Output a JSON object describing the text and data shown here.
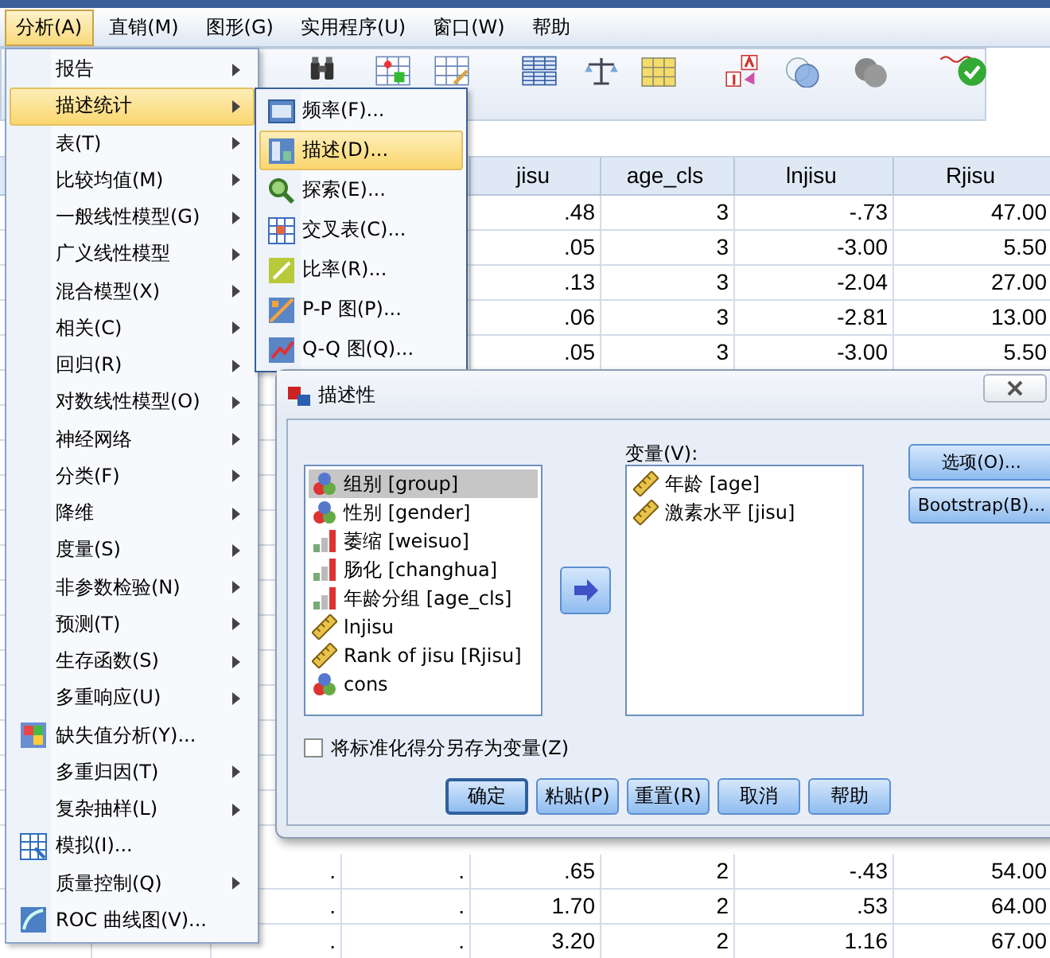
{
  "menubar": [
    {
      "label": "分析(A)",
      "selected": true
    },
    {
      "label": "直销(M)",
      "selected": false
    },
    {
      "label": "图形(G)",
      "selected": false
    },
    {
      "label": "实用程序(U)",
      "selected": false
    },
    {
      "label": "窗口(W)",
      "selected": false
    },
    {
      "label": "帮助",
      "selected": false
    }
  ],
  "table": {
    "columns": [
      {
        "label": "jisu"
      },
      {
        "label": "age_cls"
      },
      {
        "label": "lnjisu"
      },
      {
        "label": "Rjisu"
      }
    ],
    "rows": [
      {
        "cells": [
          ".48",
          "3",
          "-.73",
          "47.00"
        ]
      },
      {
        "cells": [
          ".05",
          "3",
          "-3.00",
          "5.50"
        ]
      },
      {
        "cells": [
          ".13",
          "3",
          "-2.04",
          "27.00"
        ]
      },
      {
        "cells": [
          ".06",
          "3",
          "-2.81",
          "13.00"
        ]
      },
      {
        "cells": [
          ".05",
          "3",
          "-3.00",
          "5.50"
        ]
      }
    ],
    "lower_rows": [
      {
        "cells": [
          ".",
          ".",
          ".65",
          "2",
          "-.43",
          "54.00"
        ]
      },
      {
        "cells": [
          ".",
          ".",
          "1.70",
          "2",
          ".53",
          "64.00"
        ]
      },
      {
        "cells": [
          ".",
          ".",
          "3.20",
          "2",
          "1.16",
          "67.00"
        ]
      }
    ]
  },
  "analyze_menu": {
    "items": [
      {
        "label": "报告",
        "kind": "submenu",
        "selected": false
      },
      {
        "label": "描述统计",
        "kind": "submenu",
        "selected": true
      },
      {
        "label": "表(T)",
        "kind": "submenu",
        "selected": false
      },
      {
        "label": "比较均值(M)",
        "kind": "submenu",
        "selected": false
      },
      {
        "label": "一般线性模型(G)",
        "kind": "submenu",
        "selected": false
      },
      {
        "label": "广义线性模型",
        "kind": "submenu",
        "selected": false
      },
      {
        "label": "混合模型(X)",
        "kind": "submenu",
        "selected": false
      },
      {
        "label": "相关(C)",
        "kind": "submenu",
        "selected": false
      },
      {
        "label": "回归(R)",
        "kind": "submenu",
        "selected": false
      },
      {
        "label": "对数线性模型(O)",
        "kind": "submenu",
        "selected": false
      },
      {
        "label": "神经网络",
        "kind": "submenu",
        "selected": false
      },
      {
        "label": "分类(F)",
        "kind": "submenu",
        "selected": false
      },
      {
        "label": "降维",
        "kind": "submenu",
        "selected": false
      },
      {
        "label": "度量(S)",
        "kind": "submenu",
        "selected": false
      },
      {
        "label": "非参数检验(N)",
        "kind": "submenu",
        "selected": false
      },
      {
        "label": "预测(T)",
        "kind": "submenu",
        "selected": false
      },
      {
        "label": "生存函数(S)",
        "kind": "submenu",
        "selected": false
      },
      {
        "label": "多重响应(U)",
        "kind": "submenu",
        "selected": false
      },
      {
        "label": "缺失值分析(Y)...",
        "kind": "command",
        "selected": false
      },
      {
        "label": "多重归因(T)",
        "kind": "submenu",
        "selected": false
      },
      {
        "label": "复杂抽样(L)",
        "kind": "submenu",
        "selected": false
      },
      {
        "label": "模拟(I)...",
        "kind": "command",
        "selected": false
      },
      {
        "label": "质量控制(Q)",
        "kind": "submenu",
        "selected": false
      },
      {
        "label": "ROC 曲线图(V)...",
        "kind": "command",
        "selected": false
      }
    ]
  },
  "descriptives_submenu": {
    "items": [
      {
        "label": "频率(F)...",
        "selected": false
      },
      {
        "label": "描述(D)...",
        "selected": true
      },
      {
        "label": "探索(E)...",
        "selected": false
      },
      {
        "label": "交叉表(C)...",
        "selected": false
      },
      {
        "label": "比率(R)...",
        "selected": false
      },
      {
        "label": "P-P 图(P)...",
        "selected": false
      },
      {
        "label": "Q-Q 图(Q)...",
        "selected": false
      }
    ]
  },
  "dialog": {
    "title": "描述性",
    "source_variables": [
      {
        "label": "组别 [group]",
        "kind": "nominal",
        "selected": true
      },
      {
        "label": "性别 [gender]",
        "kind": "nominal",
        "selected": false
      },
      {
        "label": "萎缩 [weisuo]",
        "kind": "ordinal",
        "selected": false
      },
      {
        "label": "肠化 [changhua]",
        "kind": "ordinal",
        "selected": false
      },
      {
        "label": "年龄分组 [age_cls]",
        "kind": "ordinal",
        "selected": false
      },
      {
        "label": "lnjisu",
        "kind": "scale",
        "selected": false
      },
      {
        "label": "Rank of jisu [Rjisu]",
        "kind": "scale",
        "selected": false
      },
      {
        "label": "cons",
        "kind": "nominal",
        "selected": false
      }
    ],
    "target_label": "变量(V):",
    "target_variables": [
      {
        "label": "年龄 [age]",
        "kind": "scale",
        "selected": false
      },
      {
        "label": "激素水平 [jisu]",
        "kind": "scale",
        "selected": false
      }
    ],
    "side_buttons": [
      "选项(O)...",
      "Bootstrap(B)..."
    ],
    "save_checkbox": {
      "label": "将标准化得分另存为变量(Z)",
      "checked": false
    },
    "buttons": [
      {
        "label": "确定",
        "default": true
      },
      {
        "label": "粘贴(P)",
        "default": false
      },
      {
        "label": "重置(R)",
        "default": false
      },
      {
        "label": "取消",
        "default": false
      },
      {
        "label": "帮助",
        "default": false
      }
    ]
  }
}
